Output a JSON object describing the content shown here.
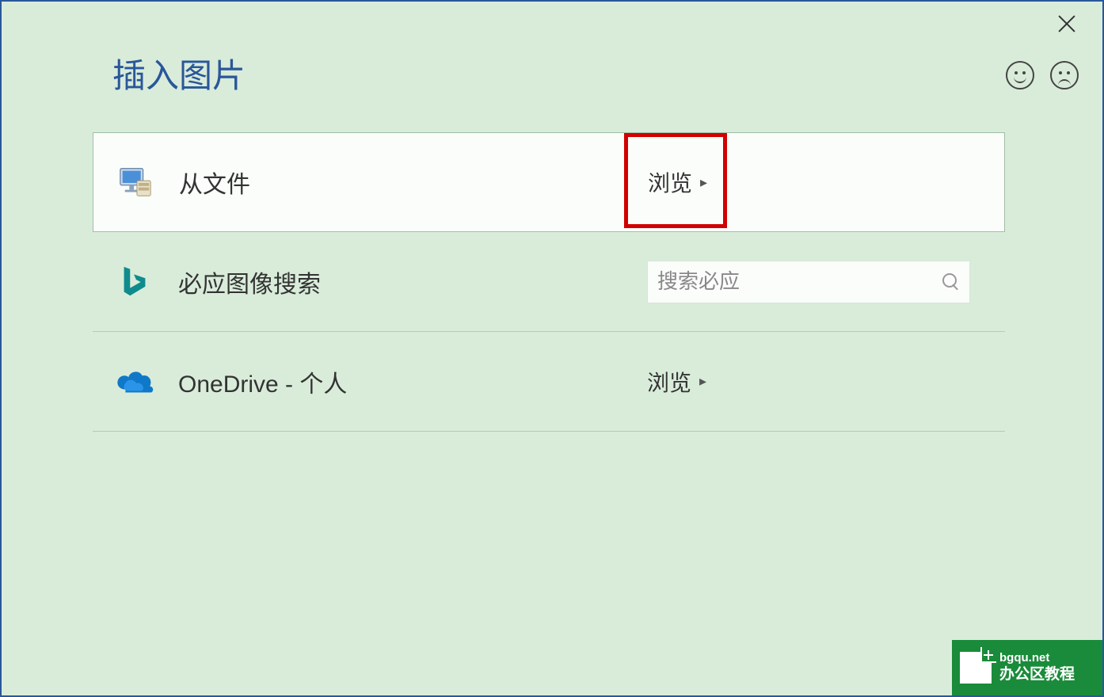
{
  "dialog": {
    "title": "插入图片"
  },
  "options": {
    "file": {
      "label": "从文件",
      "action": "浏览"
    },
    "bing": {
      "label": "必应图像搜索",
      "placeholder": "搜索必应"
    },
    "onedrive": {
      "label": "OneDrive - 个人",
      "action": "浏览"
    }
  },
  "icons": {
    "computer": "computer-icon",
    "bing": "bing-icon",
    "onedrive": "onedrive-icon",
    "close": "close-icon",
    "happy_face": "happy-face-icon",
    "sad_face": "sad-face-icon",
    "search": "search-icon",
    "chevron_right": "chevron-right-icon"
  },
  "watermark": {
    "url": "bgqu.net",
    "text": "办公区教程"
  },
  "highlight": {
    "target": "file-browse-button",
    "color": "#d10000"
  }
}
